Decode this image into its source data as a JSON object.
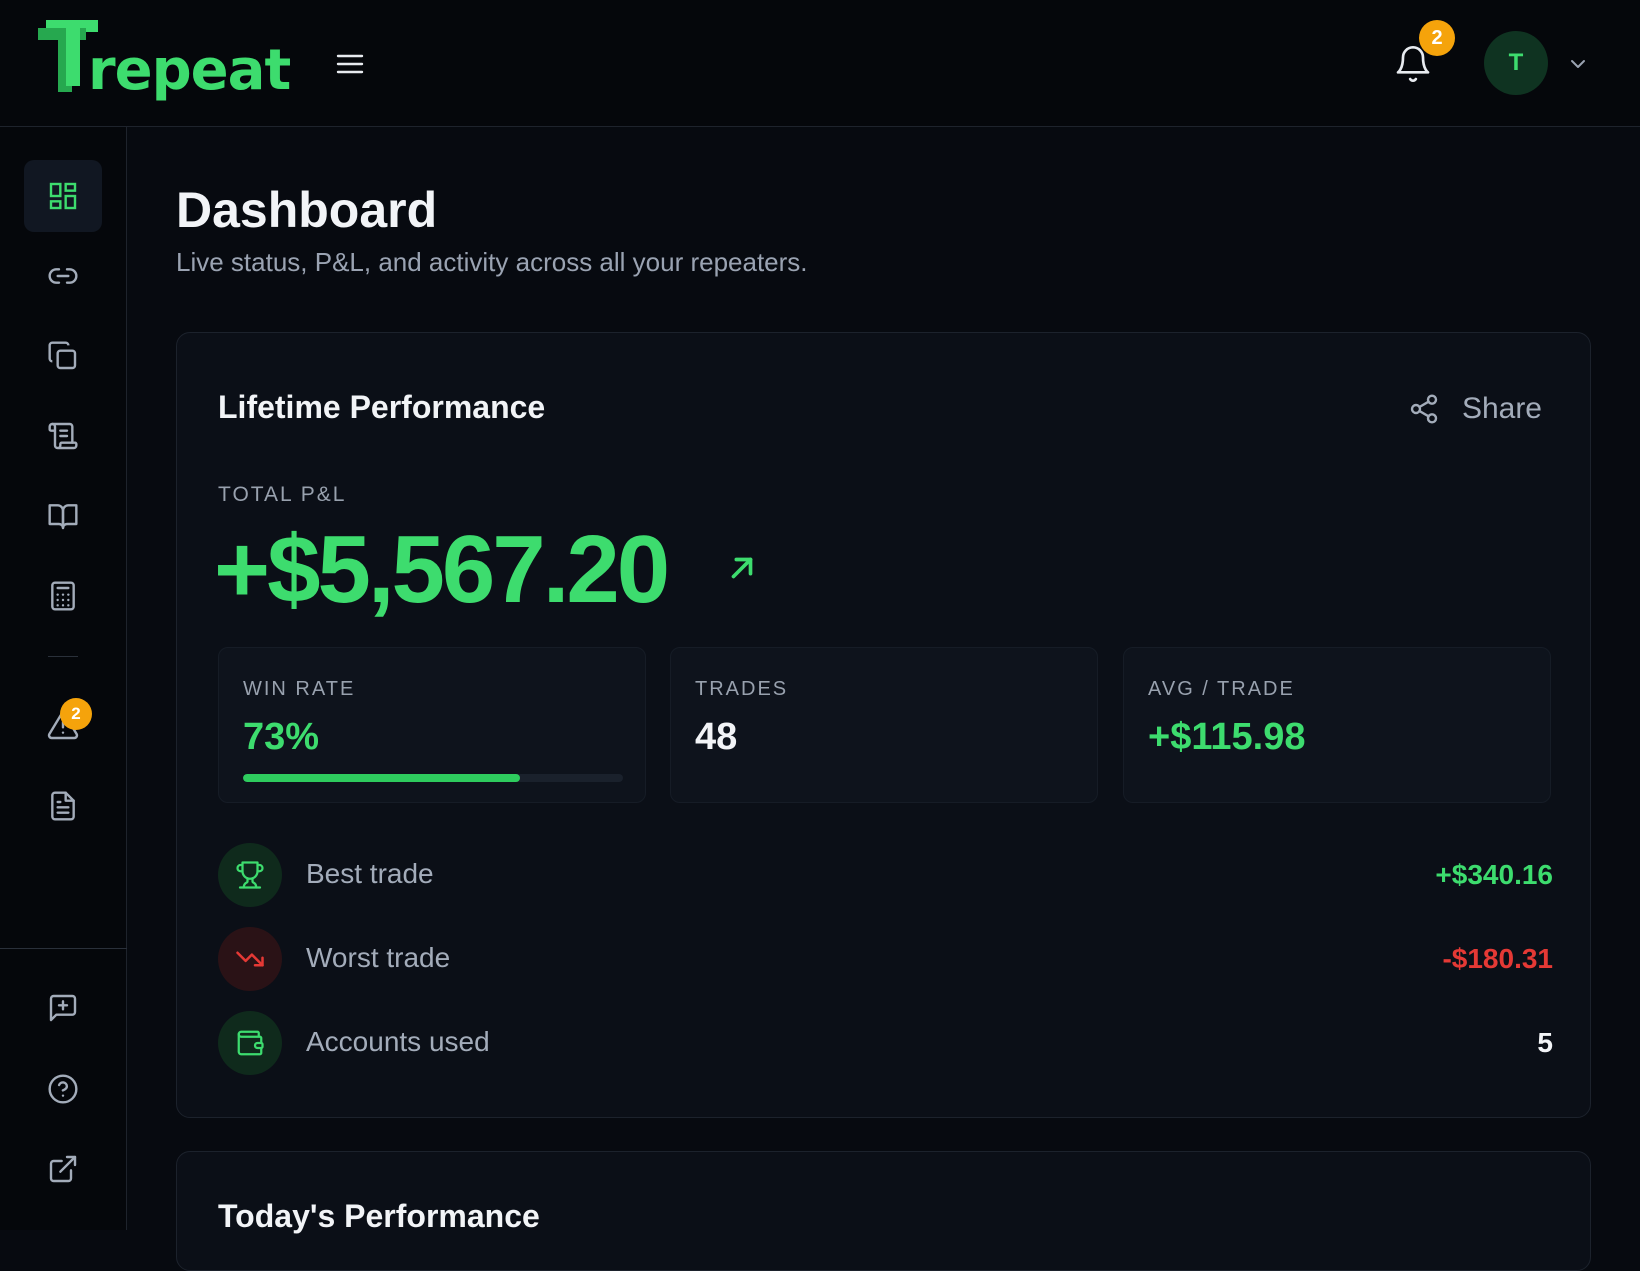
{
  "app": {
    "logo_text": "repeat",
    "notifications_count": "2",
    "avatar_initial": "T",
    "accent_color": "#3ddc6e",
    "negative_color": "#e53935",
    "badge_color": "#f5a30b"
  },
  "sidebar": {
    "items": [
      {
        "icon": "dashboard-grid-icon",
        "active": true
      },
      {
        "icon": "link-icon"
      },
      {
        "icon": "copy-icon"
      },
      {
        "icon": "scroll-icon"
      },
      {
        "icon": "book-open-icon"
      },
      {
        "icon": "calculator-icon"
      },
      {
        "icon": "alert-triangle-icon",
        "badge": "2"
      },
      {
        "icon": "document-icon"
      },
      {
        "icon": "feedback-icon"
      },
      {
        "icon": "help-circle-icon"
      },
      {
        "icon": "external-link-icon"
      }
    ],
    "alerts_badge": "2"
  },
  "page": {
    "title": "Dashboard",
    "subtitle": "Live status, P&L, and activity across all your repeaters."
  },
  "lifetime": {
    "title": "Lifetime Performance",
    "share_label": "Share",
    "total_label": "TOTAL P&L",
    "total_value": "+$5,567.20",
    "stats": {
      "win_rate_label": "WIN RATE",
      "win_rate_value": "73%",
      "win_rate_fraction": 0.73,
      "trades_label": "TRADES",
      "trades_value": "48",
      "avg_label": "AVG / TRADE",
      "avg_value": "+$115.98"
    },
    "rows": [
      {
        "label": "Best trade",
        "value": "+$340.16",
        "icon": "trophy-icon"
      },
      {
        "label": "Worst trade",
        "value": "-$180.31",
        "icon": "trending-down-icon"
      },
      {
        "label": "Accounts used",
        "value": "5",
        "icon": "wallet-icon"
      }
    ]
  },
  "today": {
    "title": "Today's Performance"
  }
}
